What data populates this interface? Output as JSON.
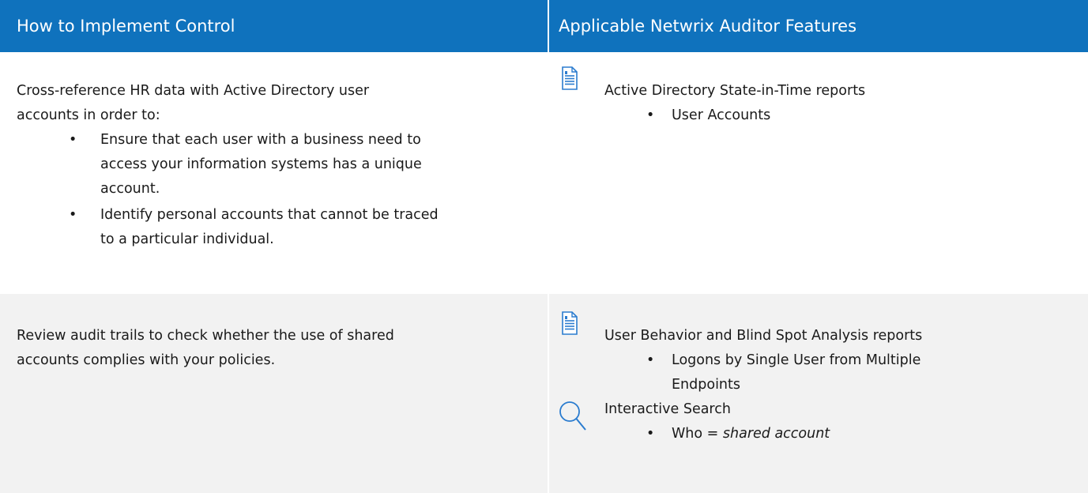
{
  "header": {
    "left": "How to Implement Control",
    "right": "Applicable Netwrix Auditor Features"
  },
  "rows": [
    {
      "control": {
        "intro_line1": "Cross-reference HR data with Active Directory user",
        "intro_line2": "accounts in order to:",
        "bullets": [
          {
            "line1": "Ensure that each user with a business need to",
            "line2": "access your information systems has a unique",
            "line3": "account."
          },
          {
            "line1": "Identify personal accounts that cannot be traced",
            "line2": "to a particular individual."
          }
        ]
      },
      "features": [
        {
          "icon": "report-document-icon",
          "title": "Active Directory State-in-Time reports",
          "items": [
            {
              "line1": "User Accounts"
            }
          ]
        }
      ]
    },
    {
      "control": {
        "intro_line1": "Review audit trails to check whether the use of shared",
        "intro_line2": "accounts complies with your policies."
      },
      "features": [
        {
          "icon": "report-document-icon",
          "title": "User Behavior and Blind Spot Analysis reports",
          "items": [
            {
              "line1": "Logons by Single User from Multiple",
              "line2": "Endpoints"
            }
          ]
        },
        {
          "icon": "search-icon",
          "title": "Interactive Search",
          "items": [
            {
              "prefix": "Who = ",
              "value": "shared account"
            }
          ]
        }
      ]
    }
  ],
  "bullet_glyph": "•",
  "colors": {
    "header_bg": "#0f72bd",
    "header_text": "#ffffff",
    "row_alt_bg": "#f2f2f2",
    "icon_blue": "#2b7ccf"
  }
}
